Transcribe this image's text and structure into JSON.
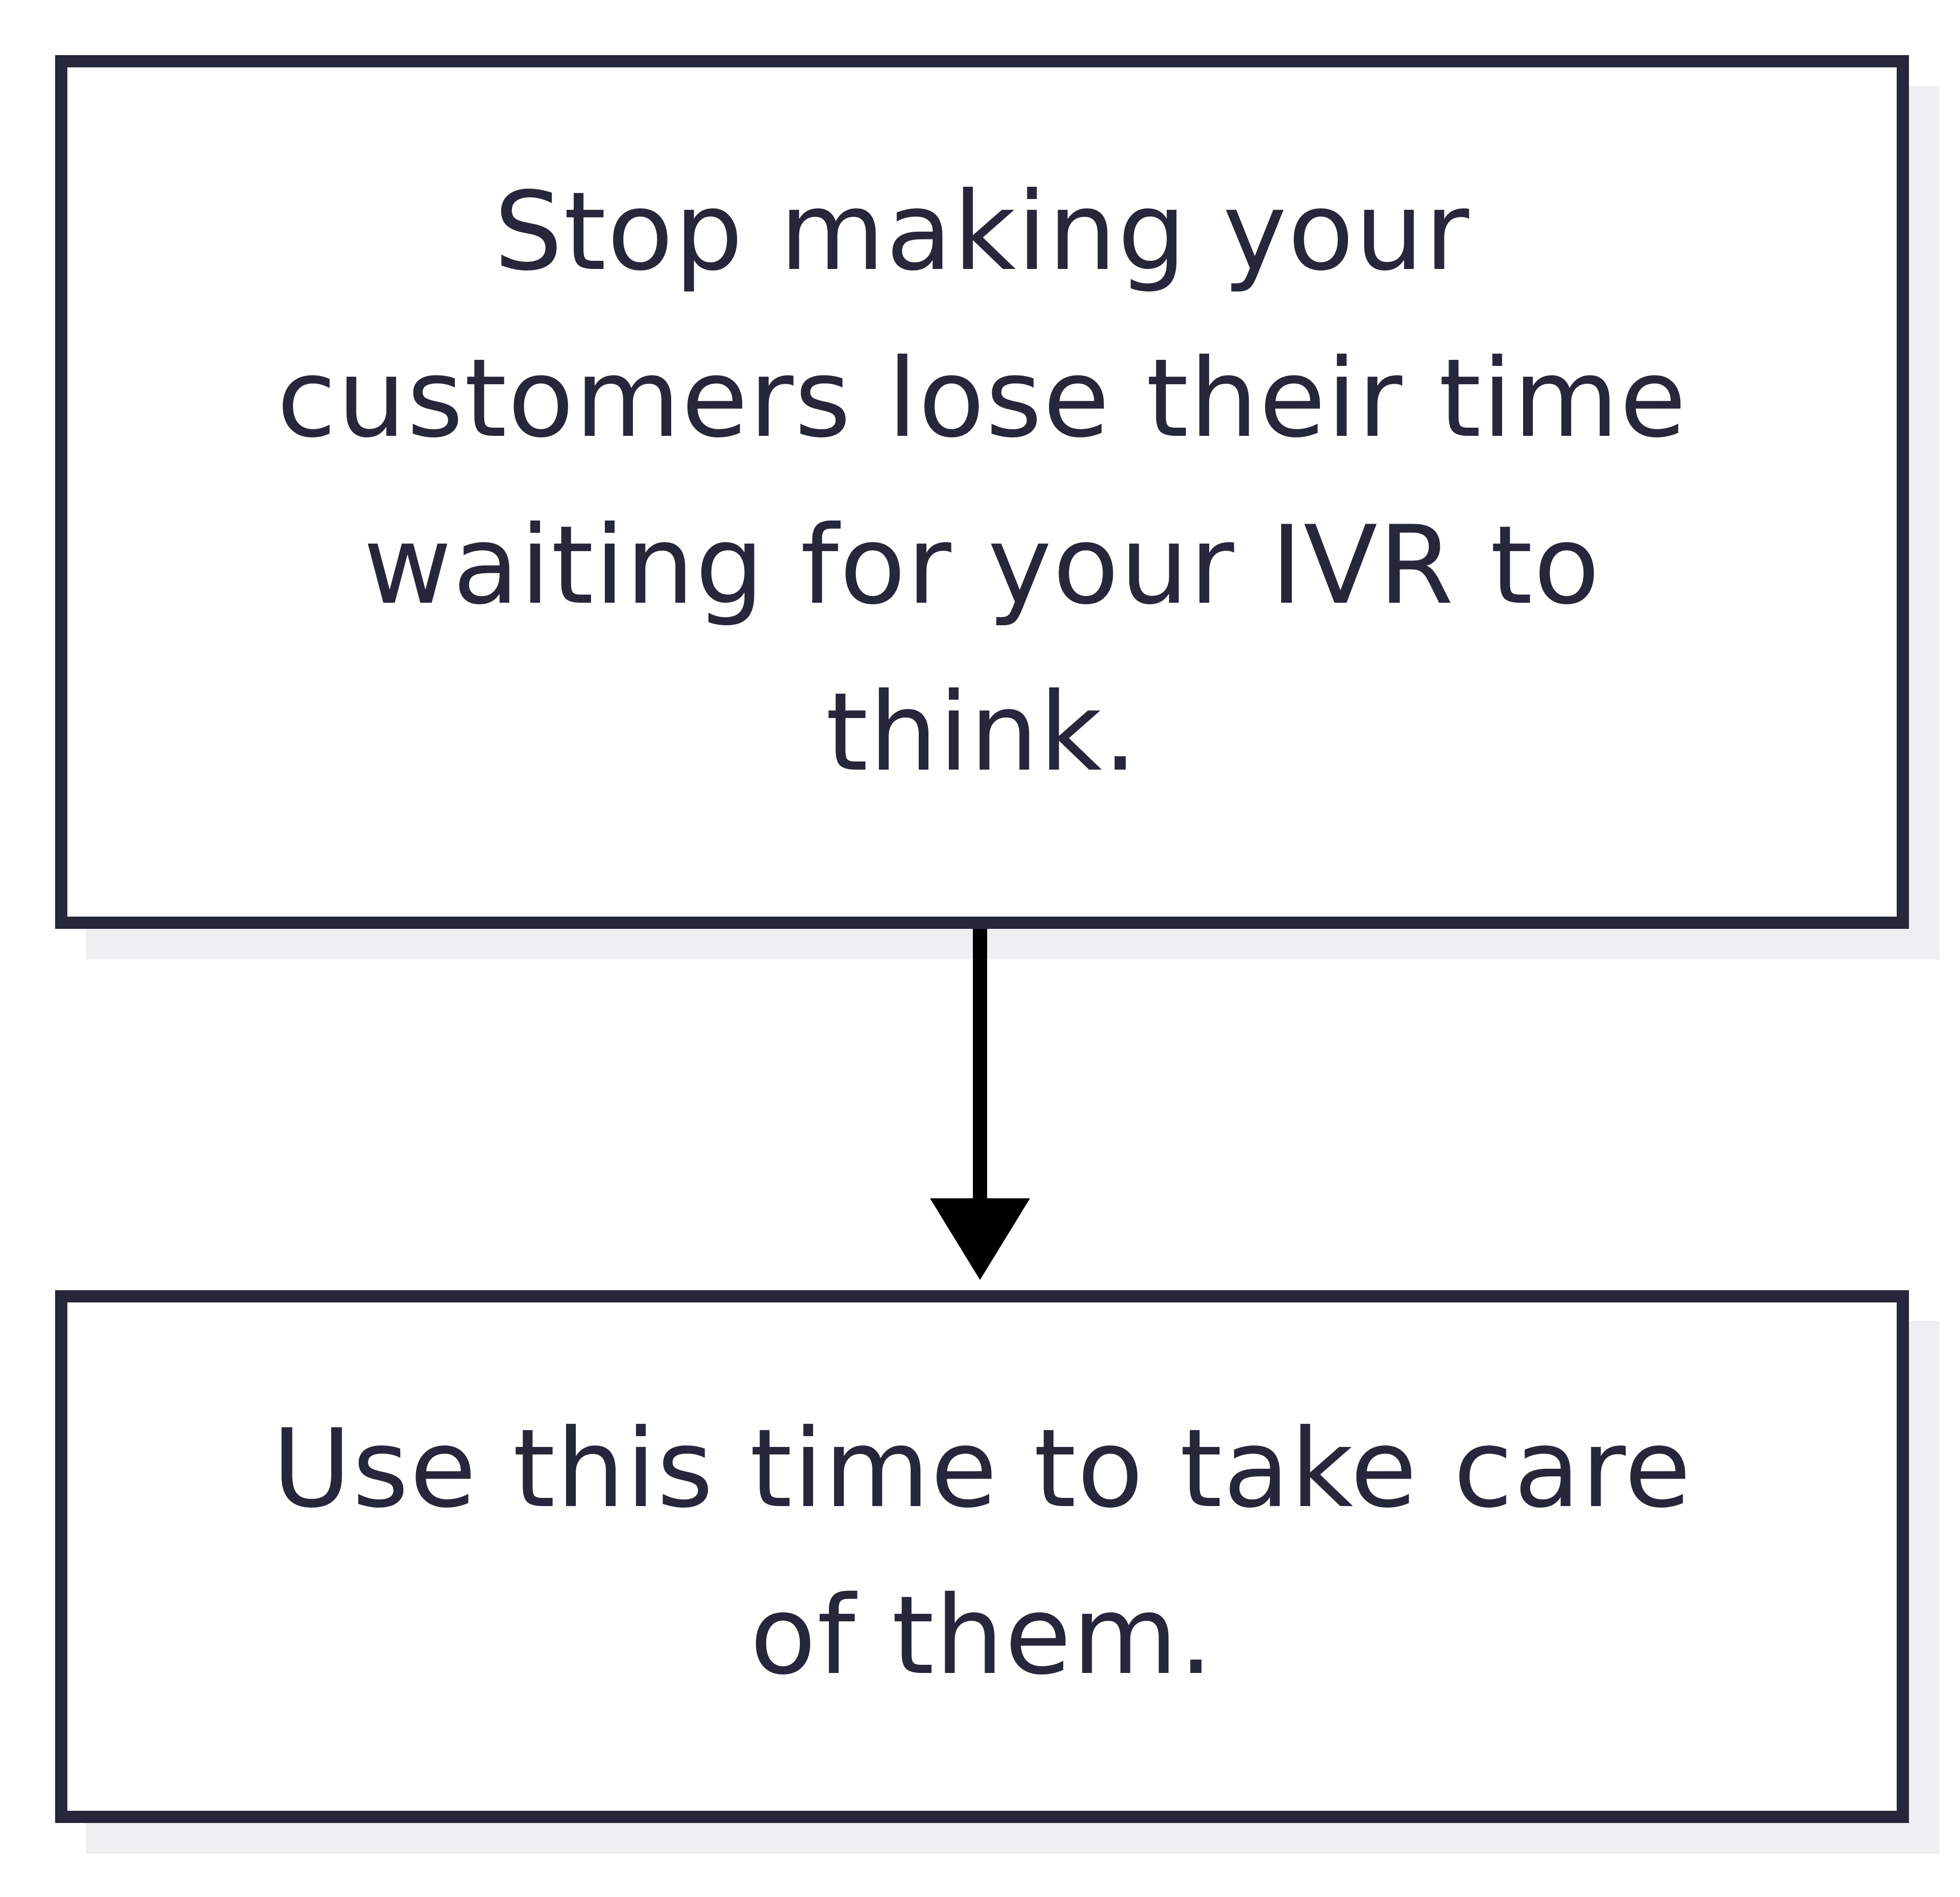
{
  "diagram": {
    "nodes": [
      {
        "id": "top",
        "text": "Stop making your customers lose their time waiting for your IVR to think."
      },
      {
        "id": "bottom",
        "text": "Use this time to take care of them."
      }
    ],
    "edges": [
      {
        "from": "top",
        "to": "bottom"
      }
    ],
    "colors": {
      "border": "#27273b",
      "text": "#27273b",
      "arrow": "#000000",
      "shadow": "#efeff1",
      "background": "#ffffff"
    }
  }
}
